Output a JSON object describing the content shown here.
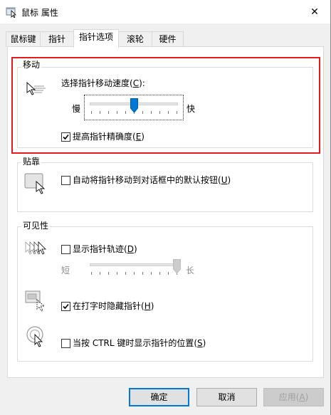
{
  "window": {
    "title": "鼠标 属性",
    "close_glyph": "✕"
  },
  "tabs": [
    {
      "label": "鼠标键",
      "active": false
    },
    {
      "label": "指针",
      "active": false
    },
    {
      "label": "指针选项",
      "active": true
    },
    {
      "label": "滚轮",
      "active": false
    },
    {
      "label": "硬件",
      "active": false
    }
  ],
  "motion": {
    "title": "移动",
    "speed_label_pre": "选择指针移动速度(",
    "speed_label_key": "C",
    "speed_label_post": "):",
    "slow": "慢",
    "fast": "快",
    "speed_level": 0.5,
    "precision_pre": "提高指针精确度(",
    "precision_key": "E",
    "precision_post": ")",
    "precision_checked": true
  },
  "snap": {
    "title": "贴靠",
    "label_pre": "自动将指针移动到对话框中的默认按钮(",
    "label_key": "U",
    "label_post": ")",
    "checked": false
  },
  "visibility": {
    "title": "可见性",
    "trails_pre": "显示指针轨迹(",
    "trails_key": "D",
    "trails_post": ")",
    "trails_checked": false,
    "short": "短",
    "long": "长",
    "trail_level": 1.0,
    "hide_pre": "在打字时隐藏指针(",
    "hide_key": "H",
    "hide_post": ")",
    "hide_checked": true,
    "ctrl_pre": "当按 CTRL 键时显示指针的位置(",
    "ctrl_key": "S",
    "ctrl_post": ")",
    "ctrl_checked": false
  },
  "buttons": {
    "ok": "确定",
    "cancel": "取消",
    "apply_pre": "应用(",
    "apply_key": "A",
    "apply_post": ")"
  },
  "colors": {
    "highlight": "#e8181f",
    "accent": "#0078d7",
    "thumb": "#0078d7"
  }
}
